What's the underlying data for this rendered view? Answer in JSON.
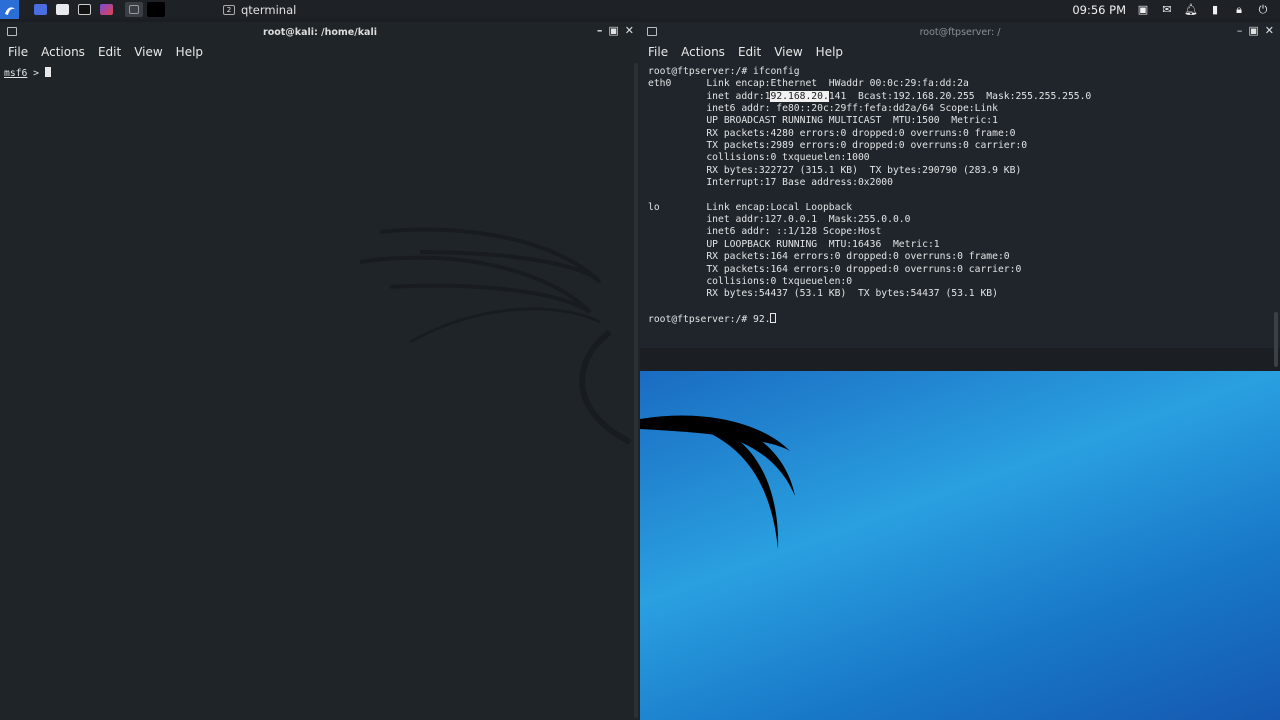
{
  "taskbar": {
    "task_label": "qterminal",
    "task_badge": "2",
    "clock": "09:56 PM",
    "tray_icons": [
      "screen-icon",
      "mail-icon",
      "bell-icon",
      "usb-icon",
      "lock-icon",
      "power-icon"
    ],
    "launcher_icons": [
      "kali-menu-icon",
      "workspace-icon",
      "file-manager-icon",
      "terminal-icon",
      "firefox-icon"
    ]
  },
  "left_window": {
    "title": "root@kali: /home/kali",
    "menu": [
      "File",
      "Actions",
      "Edit",
      "View",
      "Help"
    ],
    "prompt": "msf6",
    "prompt_sep": " > "
  },
  "right_window": {
    "title": "root@ftpserver: /",
    "menu": [
      "File",
      "Actions",
      "Edit",
      "View",
      "Help"
    ],
    "lines": {
      "l0": "root@ftpserver:/# ifconfig",
      "l1": "eth0      Link encap:Ethernet  HWaddr 00:0c:29:fa:dd:2a  ",
      "l2a": "          inet addr:1",
      "l2sel": "92.168.20.",
      "l2b": "141  Bcast:192.168.20.255  Mask:255.255.255.0",
      "l3": "          inet6 addr: fe80::20c:29ff:fefa:dd2a/64 Scope:Link",
      "l4": "          UP BROADCAST RUNNING MULTICAST  MTU:1500  Metric:1",
      "l5": "          RX packets:4280 errors:0 dropped:0 overruns:0 frame:0",
      "l6": "          TX packets:2989 errors:0 dropped:0 overruns:0 carrier:0",
      "l7": "          collisions:0 txqueuelen:1000 ",
      "l8": "          RX bytes:322727 (315.1 KB)  TX bytes:290790 (283.9 KB)",
      "l9": "          Interrupt:17 Base address:0x2000 ",
      "l10": "",
      "l11": "lo        Link encap:Local Loopback  ",
      "l12": "          inet addr:127.0.0.1  Mask:255.0.0.0",
      "l13": "          inet6 addr: ::1/128 Scope:Host",
      "l14": "          UP LOOPBACK RUNNING  MTU:16436  Metric:1",
      "l15": "          RX packets:164 errors:0 dropped:0 overruns:0 frame:0",
      "l16": "          TX packets:164 errors:0 dropped:0 overruns:0 carrier:0",
      "l17": "          collisions:0 txqueuelen:0 ",
      "l18": "          RX bytes:54437 (53.1 KB)  TX bytes:54437 (53.1 KB)",
      "l19": "",
      "l20": "root@ftpserver:/# 92."
    }
  },
  "colors": {
    "taskbar_bg": "#1e2227",
    "terminal_bg": "#1f2428",
    "desktop_blue": "#2aa0e0"
  }
}
